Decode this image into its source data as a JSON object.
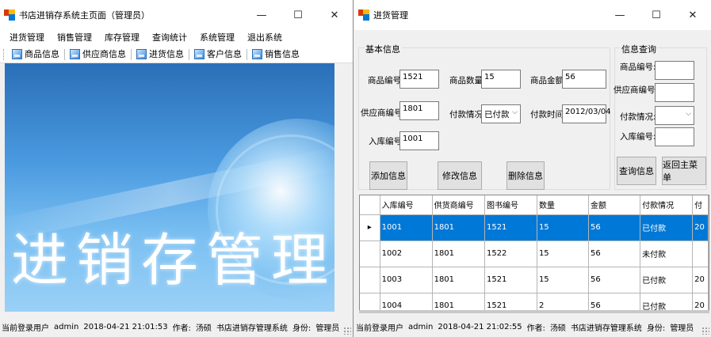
{
  "main_window": {
    "title": "书店进销存系统主页面（管理员）",
    "controls": {
      "minimize": "—",
      "maximize": "☐",
      "close": "✕"
    },
    "menu": [
      "进货管理",
      "销售管理",
      "库存管理",
      "查询统计",
      "系统管理",
      "退出系统"
    ],
    "toolbar": [
      "商品信息",
      "供应商信息",
      "进货信息",
      "客户信息",
      "销售信息"
    ],
    "banner_text": "进销存管理",
    "status": {
      "user_label": "当前登录用户",
      "user": "admin",
      "datetime": "2018-04-21 21:01:53",
      "author_label": "作者:",
      "author": "汤硕",
      "system": "书店进销存管理系统",
      "role_label": "身份:",
      "role": "管理员"
    }
  },
  "purchase_window": {
    "title": "进货管理",
    "controls": {
      "minimize": "—",
      "maximize": "☐",
      "close": "✕"
    },
    "basic_info": {
      "title": "基本信息",
      "product_id_label": "商品编号:",
      "product_id": "1521",
      "quantity_label": "商品数量:",
      "quantity": "15",
      "amount_label": "商品金额:",
      "amount": "56",
      "supplier_id_label": "供应商编号:",
      "supplier_id": "1801",
      "payment_label": "付款情况:",
      "payment": "已付款",
      "pay_time_label": "付款时间:",
      "pay_time": "2012/03/04",
      "stock_id_label": "入库编号:",
      "stock_id": "1001",
      "add_button": "添加信息",
      "edit_button": "修改信息",
      "delete_button": "删除信息"
    },
    "query": {
      "title": "信息查询",
      "product_id_label": "商品编号:",
      "supplier_id_label": "供应商编号:",
      "payment_label": "付款情况:",
      "stock_id_label": "入库编号:",
      "query_button": "查询信息",
      "back_button": "返回主菜单"
    },
    "grid": {
      "columns": [
        "入库编号",
        "供货商编号",
        "图书编号",
        "数量",
        "金额",
        "付款情况",
        "付"
      ],
      "rows": [
        [
          "1001",
          "1801",
          "1521",
          "15",
          "56",
          "已付款",
          "20"
        ],
        [
          "1002",
          "1801",
          "1522",
          "15",
          "56",
          "未付款",
          ""
        ],
        [
          "1003",
          "1801",
          "1521",
          "15",
          "56",
          "已付款",
          "20"
        ],
        [
          "1004",
          "1801",
          "1521",
          "2",
          "56",
          "已付款",
          "20"
        ]
      ],
      "selected_row": 0,
      "row_indicator": "▸"
    },
    "status": {
      "user_label": "当前登录用户",
      "user": "admin",
      "datetime": "2018-04-21 21:02:55",
      "author_label": "作者:",
      "author": "汤硕",
      "system": "书店进销存管理系统",
      "role_label": "身份:",
      "role": "管理员"
    }
  }
}
